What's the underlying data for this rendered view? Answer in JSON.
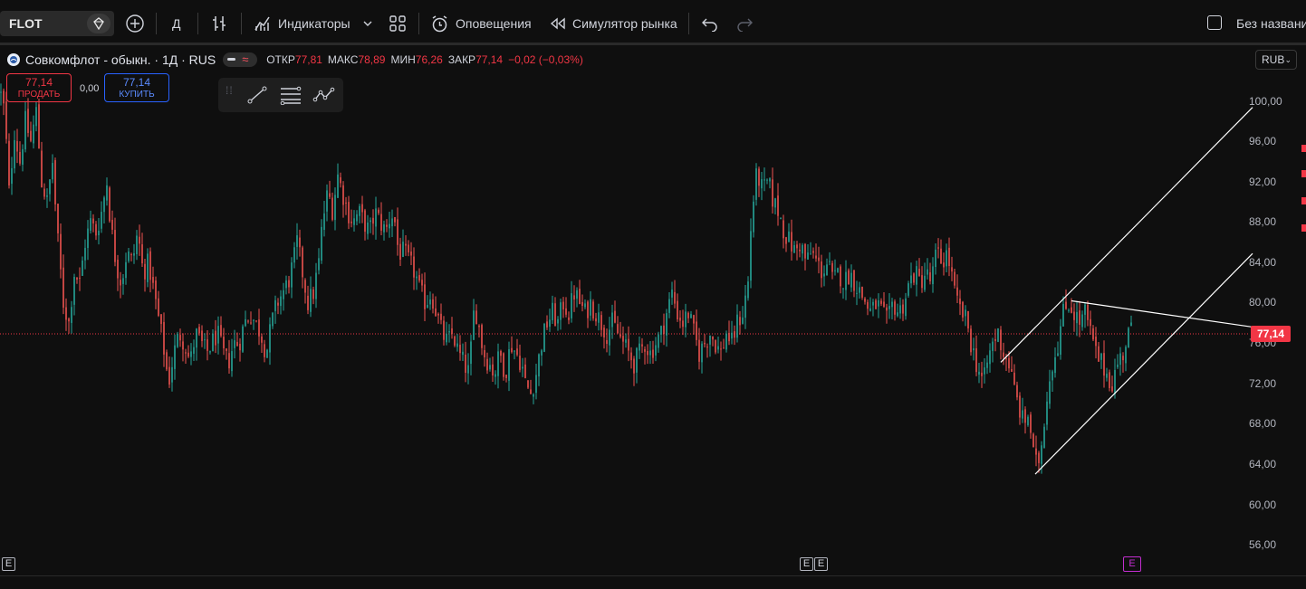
{
  "toolbar": {
    "symbol": "FLOT",
    "interval": "Д",
    "indicators_label": "Индикаторы",
    "alerts_label": "Оповещения",
    "replay_label": "Симулятор рынка",
    "layout_name": "Без названи"
  },
  "legend": {
    "title": "Совкомфлот - обыкн. · 1Д · RUS",
    "open_label": "ОТКР",
    "open": "77,81",
    "high_label": "МАКС",
    "high": "78,89",
    "low_label": "МИН",
    "low": "76,26",
    "close_label": "ЗАКР",
    "close": "77,14",
    "change": "−0,02 (−0,03%)"
  },
  "trade": {
    "sell_price": "77,14",
    "sell_label": "ПРОДАТЬ",
    "spread": "0,00",
    "buy_price": "77,14",
    "buy_label": "КУПИТЬ"
  },
  "price_axis": {
    "currency": "RUB",
    "labels": [
      "100,00",
      "96,00",
      "92,00",
      "88,00",
      "84,00",
      "80,00",
      "76,00",
      "72,00",
      "68,00",
      "64,00",
      "60,00",
      "56,00"
    ],
    "last_price": "77,14"
  },
  "events": {
    "earnings_marker": "E"
  },
  "colors": {
    "up": "#26a69a",
    "down": "#ef5350",
    "background": "#0f0f0f",
    "last_price": "#f23645"
  },
  "chart_data": {
    "type": "candlestick",
    "ylim": [
      54,
      102
    ],
    "last_close": 77.14,
    "path": [
      [
        0,
        101
      ],
      [
        5,
        99
      ],
      [
        10,
        91
      ],
      [
        16,
        97
      ],
      [
        22,
        94
      ],
      [
        28,
        98
      ],
      [
        34,
        96
      ],
      [
        40,
        99
      ],
      [
        46,
        92
      ],
      [
        52,
        90
      ],
      [
        58,
        94
      ],
      [
        63,
        87
      ],
      [
        66,
        84
      ],
      [
        70,
        80
      ],
      [
        76,
        78
      ],
      [
        82,
        83
      ],
      [
        88,
        82
      ],
      [
        94,
        86
      ],
      [
        100,
        88
      ],
      [
        106,
        87
      ],
      [
        112,
        89
      ],
      [
        118,
        92
      ],
      [
        122,
        88
      ],
      [
        128,
        84
      ],
      [
        134,
        82
      ],
      [
        140,
        85
      ],
      [
        146,
        84
      ],
      [
        152,
        87
      ],
      [
        158,
        83
      ],
      [
        164,
        84
      ],
      [
        170,
        81
      ],
      [
        176,
        78
      ],
      [
        180,
        76
      ],
      [
        186,
        72
      ],
      [
        192,
        75
      ],
      [
        198,
        77
      ],
      [
        204,
        76
      ],
      [
        210,
        74
      ],
      [
        216,
        77
      ],
      [
        222,
        76
      ],
      [
        228,
        75
      ],
      [
        234,
        76
      ],
      [
        240,
        77
      ],
      [
        246,
        75
      ],
      [
        252,
        74
      ],
      [
        258,
        76
      ],
      [
        264,
        76
      ],
      [
        270,
        78
      ],
      [
        276,
        79
      ],
      [
        282,
        78
      ],
      [
        288,
        77
      ],
      [
        294,
        75
      ],
      [
        300,
        78
      ],
      [
        306,
        80
      ],
      [
        312,
        81
      ],
      [
        318,
        82
      ],
      [
        324,
        84
      ],
      [
        328,
        86
      ],
      [
        334,
        83
      ],
      [
        340,
        80
      ],
      [
        346,
        81
      ],
      [
        352,
        84
      ],
      [
        356,
        88
      ],
      [
        362,
        91
      ],
      [
        368,
        89
      ],
      [
        372,
        93
      ],
      [
        378,
        91
      ],
      [
        384,
        89
      ],
      [
        390,
        88
      ],
      [
        396,
        89
      ],
      [
        402,
        88
      ],
      [
        408,
        87
      ],
      [
        414,
        89
      ],
      [
        420,
        88
      ],
      [
        426,
        87
      ],
      [
        432,
        89
      ],
      [
        436,
        88
      ],
      [
        440,
        85
      ],
      [
        446,
        85
      ],
      [
        452,
        84
      ],
      [
        458,
        83
      ],
      [
        464,
        81
      ],
      [
        470,
        80
      ],
      [
        476,
        81
      ],
      [
        482,
        79
      ],
      [
        488,
        77
      ],
      [
        494,
        76
      ],
      [
        500,
        77
      ],
      [
        506,
        75
      ],
      [
        512,
        74
      ],
      [
        518,
        73
      ],
      [
        524,
        80
      ],
      [
        528,
        78
      ],
      [
        534,
        75
      ],
      [
        540,
        74
      ],
      [
        546,
        73
      ],
      [
        552,
        75
      ],
      [
        558,
        73
      ],
      [
        564,
        76
      ],
      [
        570,
        75
      ],
      [
        576,
        74
      ],
      [
        580,
        72
      ],
      [
        586,
        71
      ],
      [
        592,
        73
      ],
      [
        598,
        76
      ],
      [
        604,
        78
      ],
      [
        610,
        79
      ],
      [
        616,
        78
      ],
      [
        622,
        80
      ],
      [
        628,
        79
      ],
      [
        634,
        81
      ],
      [
        640,
        80
      ],
      [
        646,
        79
      ],
      [
        652,
        80
      ],
      [
        658,
        79
      ],
      [
        664,
        78
      ],
      [
        670,
        77
      ],
      [
        676,
        78
      ],
      [
        682,
        77
      ],
      [
        688,
        76
      ],
      [
        694,
        75
      ],
      [
        700,
        74
      ],
      [
        706,
        75
      ],
      [
        712,
        76
      ],
      [
        718,
        75
      ],
      [
        724,
        76
      ],
      [
        730,
        77
      ],
      [
        736,
        79
      ],
      [
        742,
        81
      ],
      [
        748,
        79
      ],
      [
        754,
        78
      ],
      [
        760,
        79
      ],
      [
        766,
        77
      ],
      [
        772,
        75
      ],
      [
        778,
        76
      ],
      [
        784,
        77
      ],
      [
        790,
        76
      ],
      [
        796,
        75
      ],
      [
        802,
        77
      ],
      [
        808,
        76
      ],
      [
        814,
        78
      ],
      [
        820,
        79
      ],
      [
        826,
        82
      ],
      [
        830,
        89
      ],
      [
        836,
        93
      ],
      [
        842,
        91
      ],
      [
        848,
        92
      ],
      [
        854,
        90
      ],
      [
        860,
        89
      ],
      [
        866,
        87
      ],
      [
        872,
        86
      ],
      [
        878,
        85
      ],
      [
        884,
        86
      ],
      [
        890,
        84
      ],
      [
        896,
        85
      ],
      [
        902,
        84
      ],
      [
        908,
        83
      ],
      [
        914,
        84
      ],
      [
        920,
        82
      ],
      [
        926,
        83
      ],
      [
        932,
        82
      ],
      [
        938,
        83
      ],
      [
        944,
        82
      ],
      [
        950,
        81
      ],
      [
        956,
        80
      ],
      [
        962,
        79
      ],
      [
        968,
        80
      ],
      [
        974,
        79
      ],
      [
        980,
        78
      ],
      [
        986,
        80
      ],
      [
        992,
        79
      ],
      [
        998,
        80
      ],
      [
        1004,
        82
      ],
      [
        1010,
        83
      ],
      [
        1016,
        82
      ],
      [
        1022,
        83
      ],
      [
        1028,
        82
      ],
      [
        1034,
        85
      ],
      [
        1040,
        84
      ],
      [
        1046,
        85
      ],
      [
        1052,
        82
      ],
      [
        1056,
        80
      ],
      [
        1062,
        79
      ],
      [
        1068,
        78
      ],
      [
        1072,
        76
      ],
      [
        1078,
        74
      ],
      [
        1082,
        73
      ],
      [
        1086,
        72
      ],
      [
        1090,
        74
      ],
      [
        1096,
        76
      ],
      [
        1102,
        77
      ],
      [
        1108,
        75
      ],
      [
        1114,
        74
      ],
      [
        1118,
        72
      ],
      [
        1124,
        70
      ],
      [
        1130,
        68
      ],
      [
        1136,
        69
      ],
      [
        1142,
        64
      ],
      [
        1146,
        64
      ],
      [
        1150,
        66
      ],
      [
        1156,
        71
      ],
      [
        1162,
        74
      ],
      [
        1168,
        76
      ],
      [
        1174,
        79
      ],
      [
        1180,
        80
      ],
      [
        1186,
        79
      ],
      [
        1192,
        78
      ],
      [
        1198,
        79
      ],
      [
        1204,
        77
      ],
      [
        1210,
        75
      ],
      [
        1216,
        74
      ],
      [
        1222,
        73
      ],
      [
        1228,
        72
      ],
      [
        1234,
        74
      ],
      [
        1240,
        75
      ],
      [
        1246,
        77
      ],
      [
        1249,
        77.14
      ]
    ],
    "trendlines": [
      {
        "from": [
          1105,
          74.1
        ],
        "to": [
          1383,
          99.4
        ]
      },
      {
        "from": [
          1143,
          63.0
        ],
        "to": [
          1383,
          84.9
        ]
      },
      {
        "from": [
          1183,
          80.2
        ],
        "to": [
          1383,
          77.6
        ]
      }
    ]
  }
}
